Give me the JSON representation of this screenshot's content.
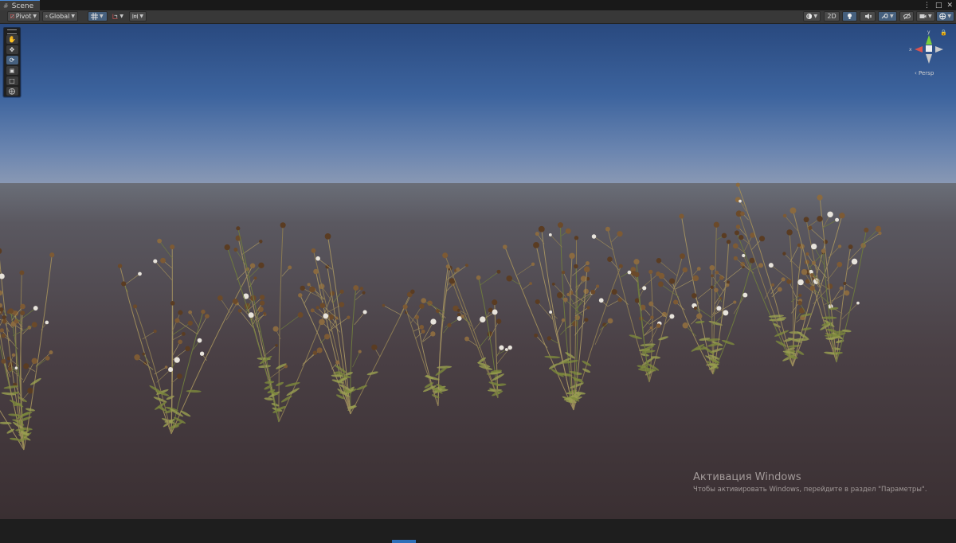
{
  "window": {
    "tab_label": "Scene"
  },
  "toolbar": {
    "pivot_label": "Pivot",
    "global_label": "Global",
    "view_2d_label": "2D"
  },
  "tools": [
    "hand-tool",
    "move-tool",
    "rotate-tool",
    "scale-tool",
    "rect-tool",
    "transform-tool"
  ],
  "gizmo": {
    "axis_y": "y",
    "axis_x": "x",
    "projection_label": "‹ Persp"
  },
  "watermark": {
    "title": "Активация Windows",
    "subtitle": "Чтобы активировать Windows, перейдите в раздел \"Параметры\"."
  },
  "colors": {
    "accent": "#46607e",
    "sky_top": "#2c4f8c",
    "horizon": "#7a8090",
    "ground": "#45393a"
  }
}
